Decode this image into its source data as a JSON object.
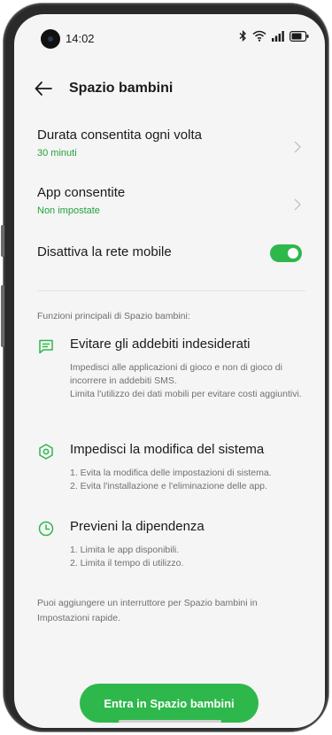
{
  "status_bar": {
    "time": "14:02",
    "icons": [
      "bluetooth-icon",
      "wifi-icon",
      "signal-icon",
      "battery-icon"
    ]
  },
  "header": {
    "title": "Spazio bambini"
  },
  "settings": {
    "duration": {
      "label": "Durata consentita ogni volta",
      "value": "30 minuti"
    },
    "apps": {
      "label": "App consentite",
      "value": "Non impostate"
    },
    "mobile_data": {
      "label": "Disattiva la rete mobile",
      "enabled": true
    }
  },
  "features": {
    "heading": "Funzioni principali di Spazio bambini:",
    "items": [
      {
        "icon": "message-icon",
        "title": "Evitare gli addebiti indesiderati",
        "desc": "Impedisci alle applicazioni di gioco e non di gioco di incorrere in addebiti SMS.\nLimita l'utilizzo dei dati mobili per evitare costi aggiuntivi."
      },
      {
        "icon": "shield-icon",
        "title": "Impedisci la modifica del sistema",
        "desc": "1. Evita la modifica delle impostazioni di sistema.\n2. Evita l'installazione e l'eliminazione delle app."
      },
      {
        "icon": "clock-icon",
        "title": "Previeni la dipendenza",
        "desc": "1. Limita le app disponibili.\n2. Limita il tempo di utilizzo."
      }
    ]
  },
  "note": "Puoi aggiungere un interruttore per Spazio bambini in Impostazioni rapide.",
  "cta": {
    "label": "Entra in Spazio bambini"
  },
  "colors": {
    "accent": "#2eb84c",
    "accent_text": "#22a33a",
    "background": "#f5f5f5"
  }
}
